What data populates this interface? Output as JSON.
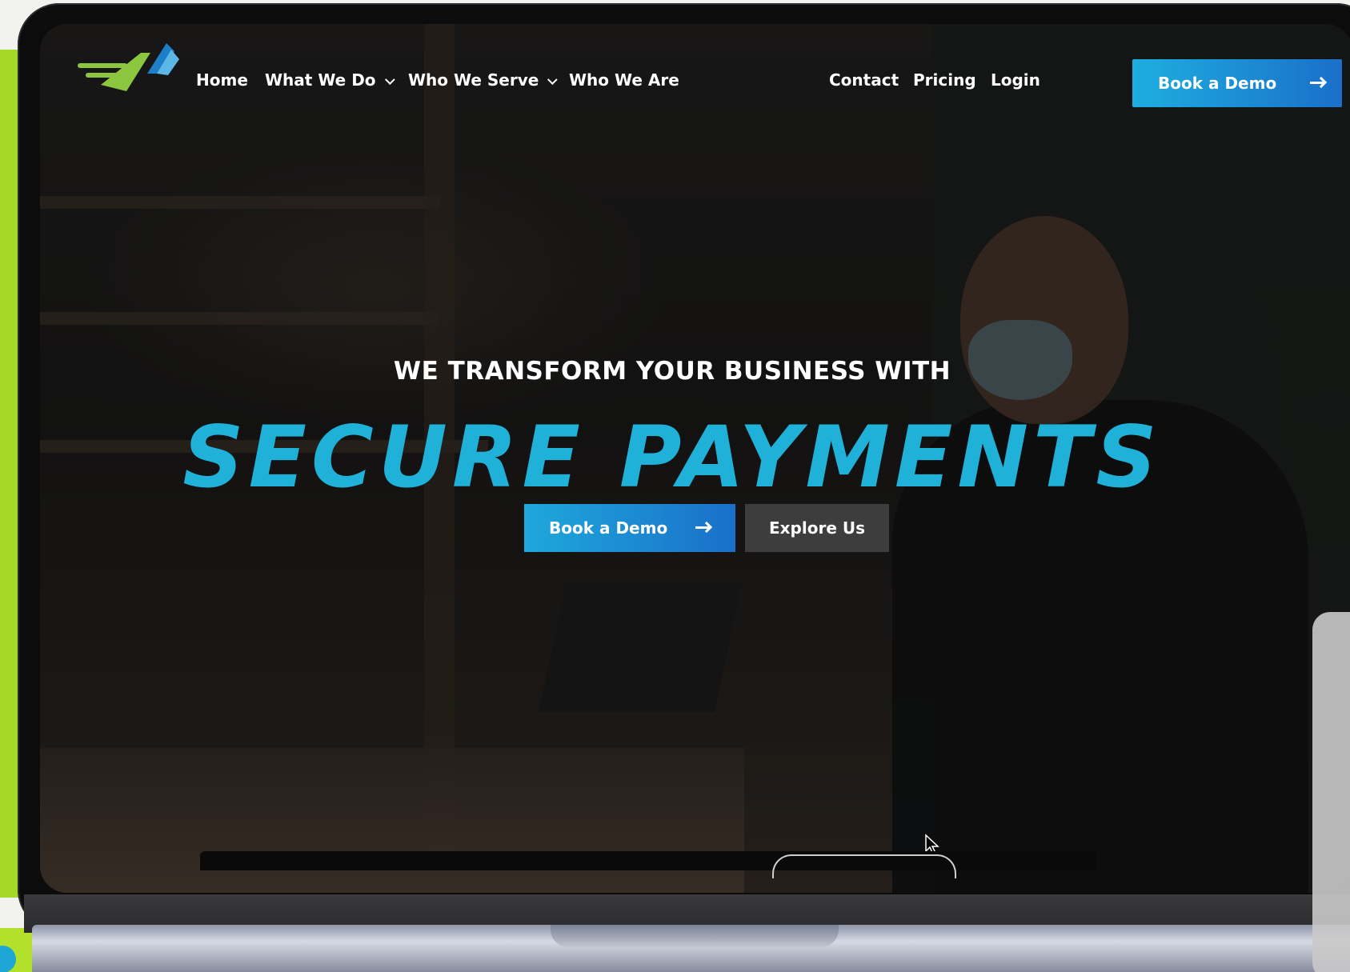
{
  "nav": {
    "home": "Home",
    "what_we_do": "What We Do",
    "who_we_serve": "Who We Serve",
    "who_we_are": "Who We Are",
    "contact": "Contact",
    "pricing": "Pricing",
    "login": "Login",
    "cta": "Book a Demo"
  },
  "hero": {
    "kicker": "WE TRANSFORM YOUR BUSINESS WITH",
    "title": "SECURE PAYMENTS",
    "primary_button": "Book a Demo",
    "secondary_button": "Explore Us"
  },
  "colors": {
    "accent_blue": "#1fb1d8",
    "brand_lime": "#a6d82a",
    "cta_gradient_start": "#1eaee0",
    "cta_gradient_end": "#1a6fc9"
  },
  "icons": {
    "logo": "brand-logo-arrow",
    "arrow": "arrow-right-icon",
    "chevron": "chevron-down-icon",
    "cursor": "mouse-pointer-icon"
  }
}
